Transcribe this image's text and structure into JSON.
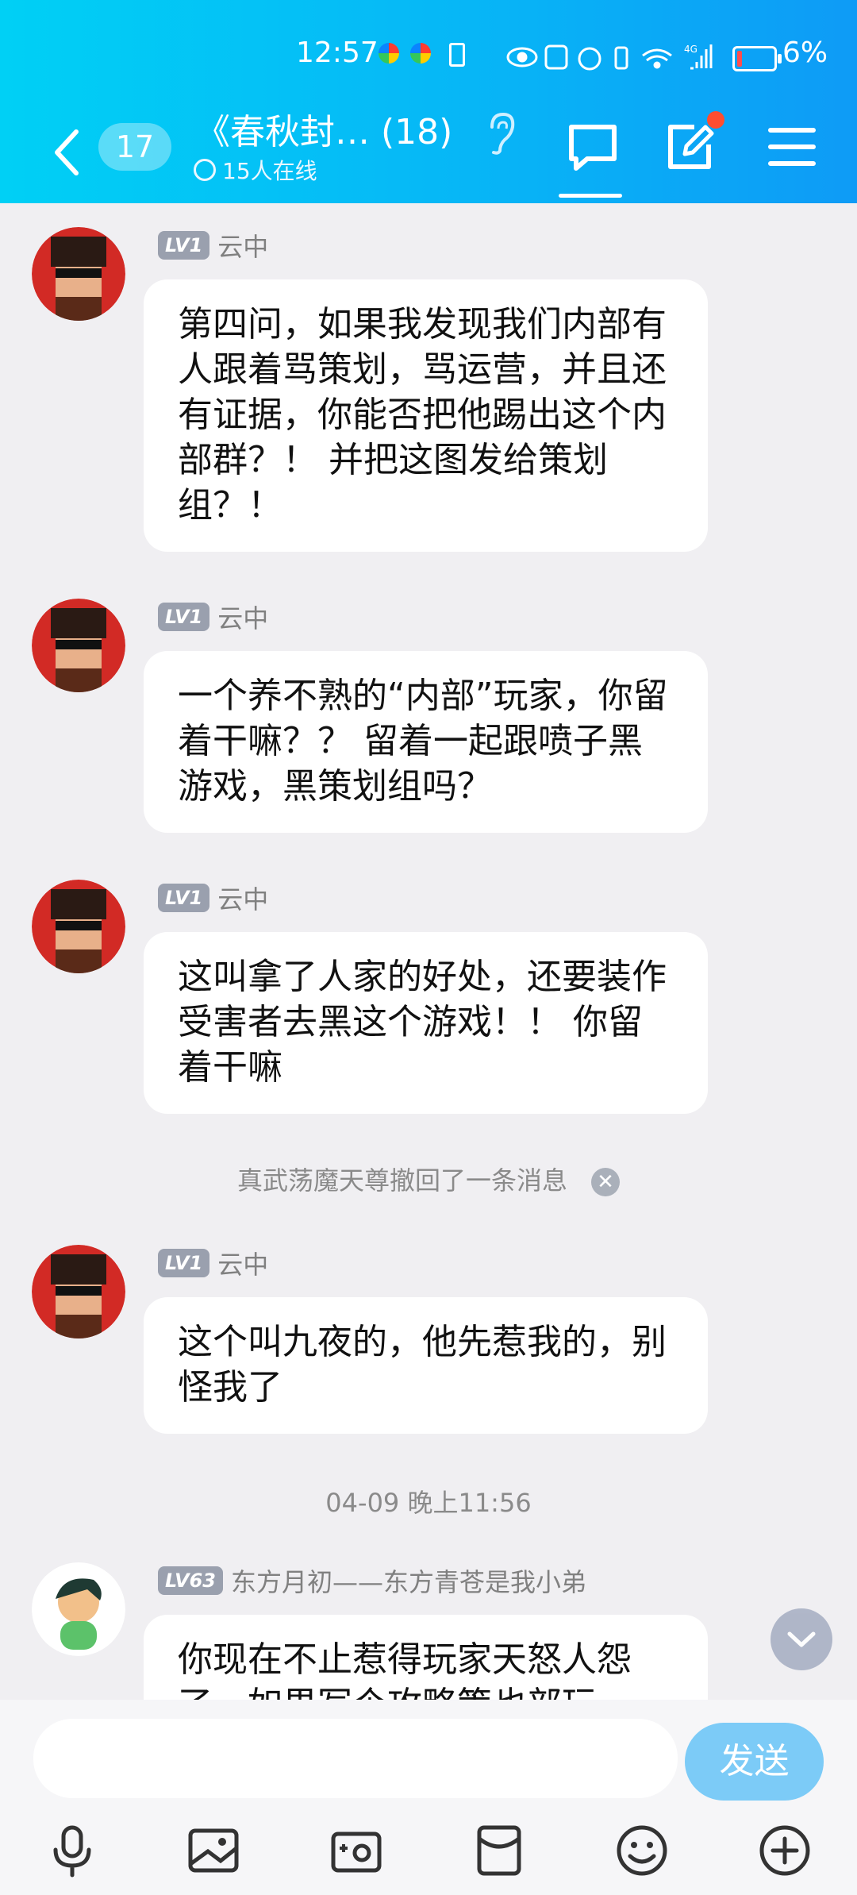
{
  "status_bar": {
    "time": "12:57",
    "battery_percent": "6%",
    "battery_level": 0.06
  },
  "header": {
    "unread_count": "17",
    "group_title": "《春秋封…  (18)",
    "online_text": "15人在线"
  },
  "messages": [
    {
      "level": "LV1",
      "sender": "云中",
      "text": "第四问，如果我发现我们内部有人跟着骂策划，骂运营，并且还有证据，你能否把他踢出这个内部群？！ 并把这图发给策划组？！"
    },
    {
      "level": "LV1",
      "sender": "云中",
      "text": "一个养不熟的“内部”玩家，你留着干嘛？？ 留着一起跟喷子黑游戏，黑策划组吗？"
    },
    {
      "level": "LV1",
      "sender": "云中",
      "text": "这叫拿了人家的好处，还要装作受害者去黑这个游戏！！ 你留着干嘛"
    },
    {
      "level": "LV1",
      "sender": "云中",
      "text": "这个叫九夜的，他先惹我的，别怪我了"
    },
    {
      "level": "LV63",
      "sender": "东方月初——东方青苍是我小弟",
      "text": "你现在不止惹得玩家天怒人怨了，如果写个攻略策也部玩"
    }
  ],
  "system": {
    "recall_notice": "真武荡魔天尊撤回了一条消息",
    "timestamp": "04-09 晚上11:56"
  },
  "input_bar": {
    "send_label": "发送",
    "input_value": ""
  },
  "icons": {
    "back": "chevron-left-icon",
    "listen": "ear-icon",
    "chat": "chat-bubble-icon",
    "edit": "edit-icon",
    "menu": "menu-icon",
    "scroll_down": "chevron-down-icon",
    "toolbar": [
      "microphone-icon",
      "image-icon",
      "camera-icon",
      "red-packet-icon",
      "emoji-icon",
      "plus-icon"
    ]
  },
  "colors": {
    "header_gradient_start": "#00d0f5",
    "header_gradient_end": "#0e9bf6",
    "send_button": "#7ccbf7",
    "unread_dot": "#ff4d30"
  }
}
